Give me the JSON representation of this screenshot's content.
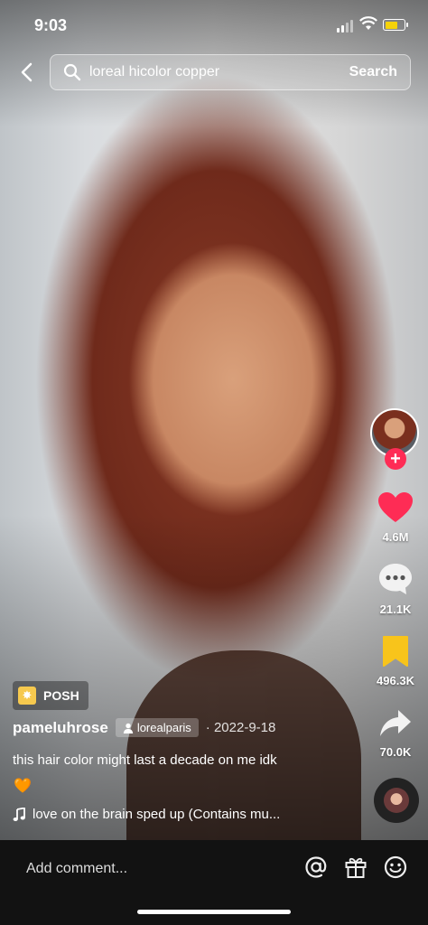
{
  "status_bar": {
    "time": "9:03"
  },
  "search": {
    "query": "loreal hicolor copper",
    "button": "Search"
  },
  "actions": {
    "likes": "4.6M",
    "comments": "21.1K",
    "saves": "496.3K",
    "shares": "70.0K"
  },
  "post": {
    "badge": "POSH",
    "username": "pameluhrose",
    "tagged_account": "lorealparis",
    "date": "· 2022-9-18",
    "caption": "this hair color might last a decade on me idk",
    "emoji": "🧡",
    "music": "love on the brain sped up (Contains mu..."
  },
  "comment_bar": {
    "placeholder": "Add comment..."
  },
  "colors": {
    "like": "#fe2c55",
    "save": "#f8c41b",
    "battery": "#f5d20a"
  }
}
